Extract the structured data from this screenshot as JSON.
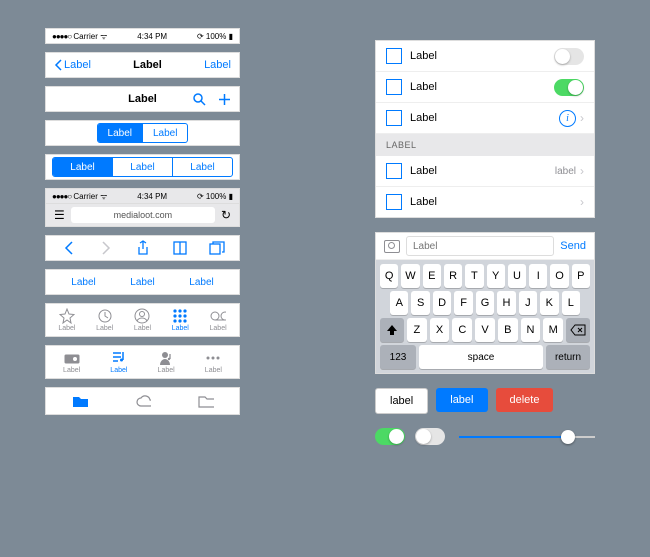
{
  "status": {
    "carrier": "Carrier",
    "time": "4:34 PM",
    "battery": "100%"
  },
  "nav1": {
    "back": "Label",
    "title": "Label",
    "right": "Label"
  },
  "nav2": {
    "title": "Label"
  },
  "seg2": {
    "a": "Label",
    "b": "Label"
  },
  "seg3": {
    "a": "Label",
    "b": "Label",
    "c": "Label"
  },
  "addr": {
    "carrier": "Carrier",
    "time": "4:34 PM",
    "battery": "100%",
    "url": "medialoot.com"
  },
  "tabs_text": {
    "a": "Label",
    "b": "Label",
    "c": "Label"
  },
  "tabs_icon1": {
    "a": "Label",
    "b": "Label",
    "c": "Label",
    "d": "Label",
    "e": "Label"
  },
  "tabs_icon2": {
    "a": "Label",
    "b": "Label",
    "c": "Label",
    "d": "Label"
  },
  "tabs_icon3": {
    "a": "",
    "b": "",
    "c": ""
  },
  "list1": {
    "r1": "Label",
    "r2": "Label",
    "r3": "Label"
  },
  "list_header": "LABEL",
  "list2": {
    "r1": "Label",
    "r1r": "label",
    "r2": "Label"
  },
  "input": {
    "placeholder": "Label",
    "send": "Send"
  },
  "keyboard": {
    "num": "123",
    "space": "space",
    "return": "return",
    "r1": [
      "Q",
      "W",
      "E",
      "R",
      "T",
      "Y",
      "U",
      "I",
      "O",
      "P"
    ],
    "r2": [
      "A",
      "S",
      "D",
      "F",
      "G",
      "H",
      "J",
      "K",
      "L"
    ],
    "r3": [
      "Z",
      "X",
      "C",
      "V",
      "B",
      "N",
      "M"
    ]
  },
  "buttons": {
    "b1": "label",
    "b2": "label",
    "b3": "delete"
  }
}
